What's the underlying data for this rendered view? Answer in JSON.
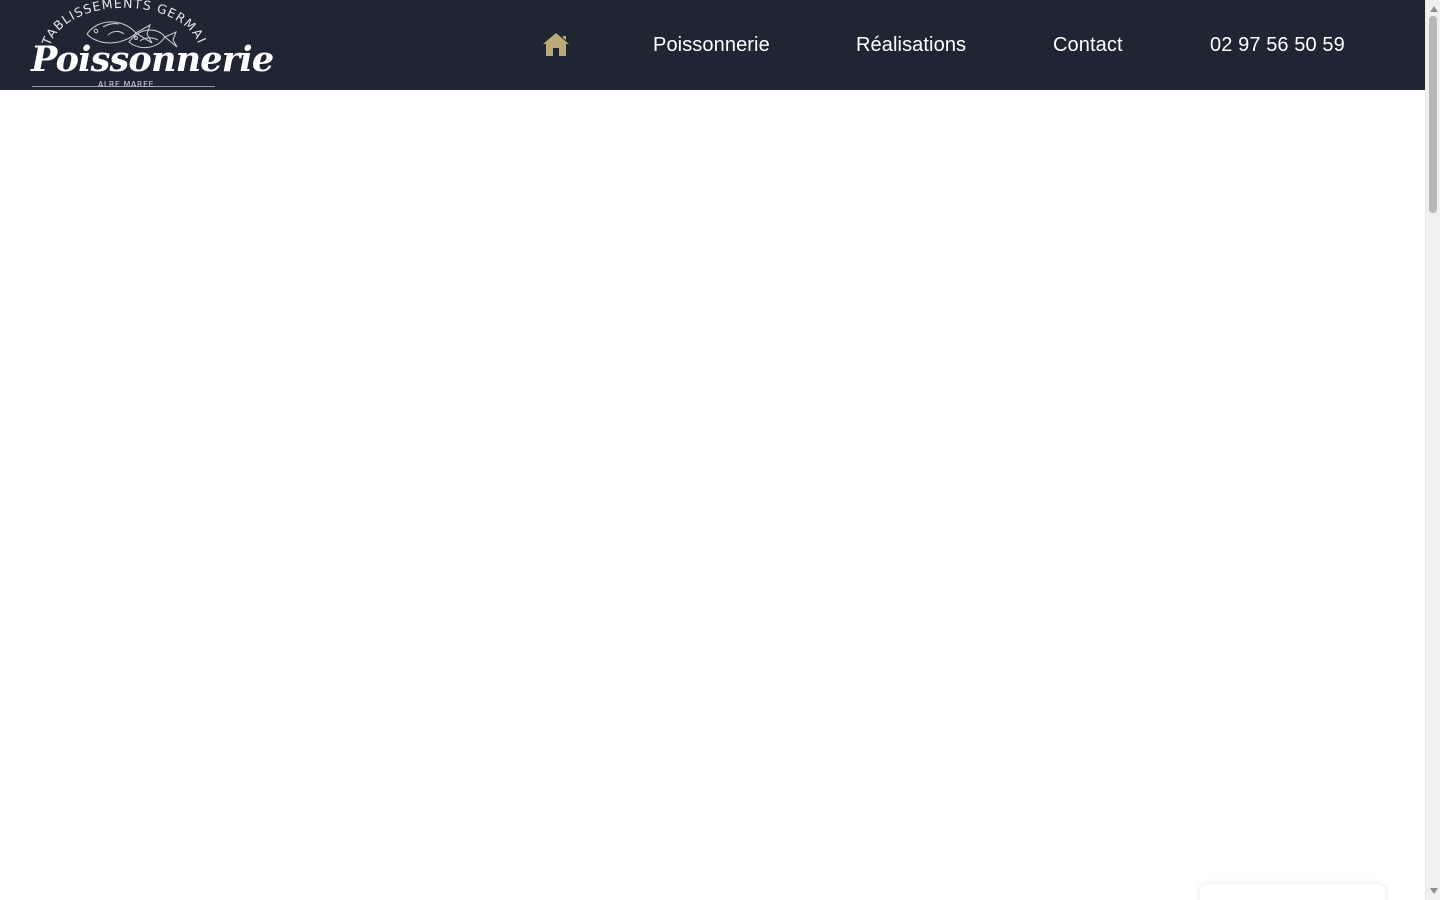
{
  "logo": {
    "arc_text": "ETABLISSEMENTS GERMAIN",
    "script_text": "Poissonnerie",
    "subtext": "ALRE MAREE"
  },
  "nav": {
    "home_icon": "home-icon",
    "items": [
      {
        "label": "Poissonnerie"
      },
      {
        "label": "Réalisations"
      },
      {
        "label": "Contact"
      }
    ],
    "phone": "02 97 56 50 59"
  },
  "colors": {
    "header_background": "#1f2533",
    "home_icon": "#bda878",
    "text": "#ffffff",
    "page_background": "#ffffff"
  }
}
